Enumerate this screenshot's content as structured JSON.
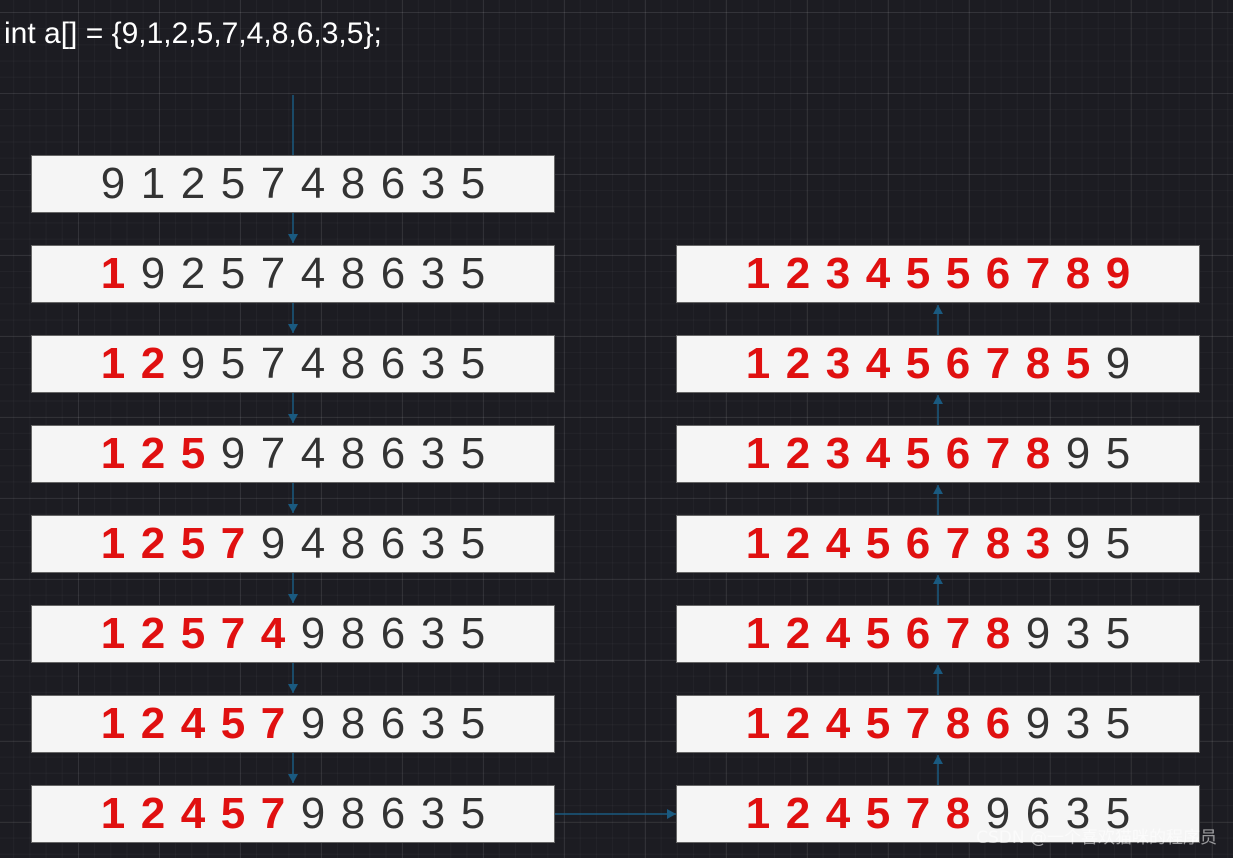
{
  "code_label": "int a[] = {9,1,2,5,7,4,8,6,3,5};",
  "colors": {
    "background": "#1c1c22",
    "box_fill": "#f5f5f5",
    "box_border": "#666666",
    "digit_default": "#333333",
    "digit_highlight": "#e01010",
    "connector": "#1a5a80"
  },
  "left_steps": [
    {
      "digits": [
        "9",
        "1",
        "2",
        "5",
        "7",
        "4",
        "8",
        "6",
        "3",
        "5"
      ],
      "highlighted": 0
    },
    {
      "digits": [
        "1",
        "9",
        "2",
        "5",
        "7",
        "4",
        "8",
        "6",
        "3",
        "5"
      ],
      "highlighted": 1
    },
    {
      "digits": [
        "1",
        "2",
        "9",
        "5",
        "7",
        "4",
        "8",
        "6",
        "3",
        "5"
      ],
      "highlighted": 2
    },
    {
      "digits": [
        "1",
        "2",
        "5",
        "9",
        "7",
        "4",
        "8",
        "6",
        "3",
        "5"
      ],
      "highlighted": 3
    },
    {
      "digits": [
        "1",
        "2",
        "5",
        "7",
        "9",
        "4",
        "8",
        "6",
        "3",
        "5"
      ],
      "highlighted": 4
    },
    {
      "digits": [
        "1",
        "2",
        "5",
        "7",
        "4",
        "9",
        "8",
        "6",
        "3",
        "5"
      ],
      "highlighted": 5
    },
    {
      "digits": [
        "1",
        "2",
        "4",
        "5",
        "7",
        "9",
        "8",
        "6",
        "3",
        "5"
      ],
      "highlighted": 5
    },
    {
      "digits": [
        "1",
        "2",
        "4",
        "5",
        "7",
        "9",
        "8",
        "6",
        "3",
        "5"
      ],
      "highlighted": 5
    }
  ],
  "right_steps": [
    {
      "digits": [
        "1",
        "2",
        "3",
        "4",
        "5",
        "5",
        "6",
        "7",
        "8",
        "9"
      ],
      "highlighted": 10
    },
    {
      "digits": [
        "1",
        "2",
        "3",
        "4",
        "5",
        "6",
        "7",
        "8",
        "5",
        "9"
      ],
      "highlighted": 9
    },
    {
      "digits": [
        "1",
        "2",
        "3",
        "4",
        "5",
        "6",
        "7",
        "8",
        "9",
        "5"
      ],
      "highlighted": 8
    },
    {
      "digits": [
        "1",
        "2",
        "4",
        "5",
        "6",
        "7",
        "8",
        "3",
        "9",
        "5"
      ],
      "highlighted": 8
    },
    {
      "digits": [
        "1",
        "2",
        "4",
        "5",
        "6",
        "7",
        "8",
        "9",
        "3",
        "5"
      ],
      "highlighted": 7
    },
    {
      "digits": [
        "1",
        "2",
        "4",
        "5",
        "7",
        "8",
        "6",
        "9",
        "3",
        "5"
      ],
      "highlighted": 7
    },
    {
      "digits": [
        "1",
        "2",
        "4",
        "5",
        "7",
        "8",
        "9",
        "6",
        "3",
        "5"
      ],
      "highlighted": 6
    }
  ],
  "watermark": "CSDN @一个喜欢猫咪的程序员"
}
